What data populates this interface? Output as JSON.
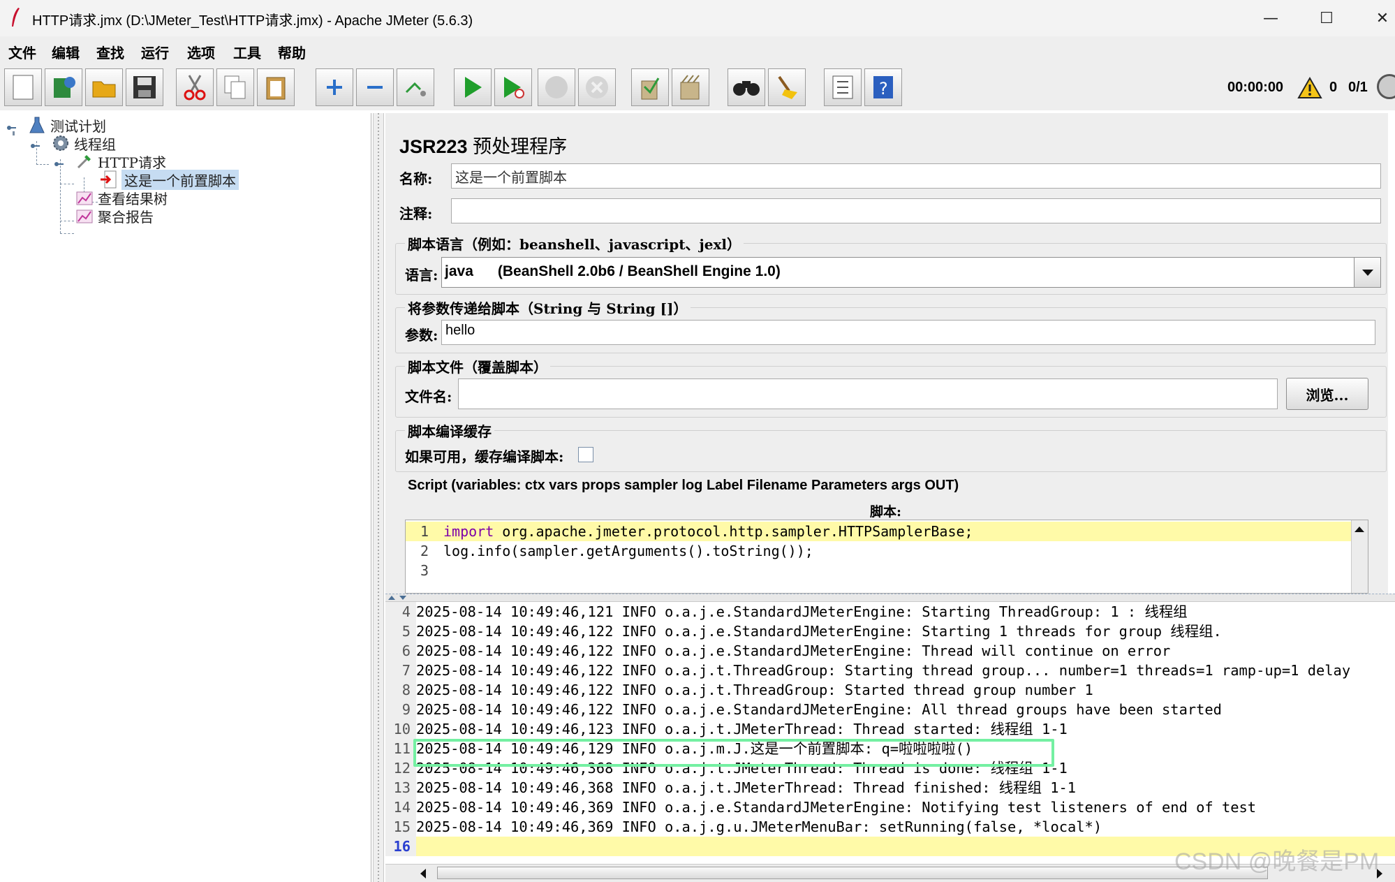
{
  "window": {
    "title": "HTTP请求.jmx (D:\\JMeter_Test\\HTTP请求.jmx) - Apache JMeter (5.6.3)",
    "minimize": "—",
    "maximize": "☐",
    "close": "✕"
  },
  "menu": [
    "文件",
    "编辑",
    "查找",
    "运行",
    "选项",
    "工具",
    "帮助"
  ],
  "toolbar": {
    "buttons": [
      "new-icon",
      "templates-icon",
      "open-icon",
      "save-icon",
      "cut-icon",
      "copy-icon",
      "paste-icon",
      "expand-icon",
      "collapse-icon",
      "toggle-icon",
      "start-icon",
      "start-no-pause-icon",
      "stop-icon",
      "shutdown-icon",
      "clear-icon",
      "clear-all-icon",
      "search-icon",
      "reset-search-icon",
      "function-helper-icon",
      "help-icon"
    ],
    "timer": "00:00:00",
    "error_count": "0",
    "threads": "0/1"
  },
  "tree": {
    "nodes": [
      {
        "label": "测试计划",
        "icon": "test-plan-icon"
      },
      {
        "label": "线程组",
        "icon": "gear-icon"
      },
      {
        "label": "HTTP请求",
        "icon": "pipette-icon"
      },
      {
        "label": "这是一个前置脚本",
        "icon": "preprocessor-icon",
        "selected": true
      },
      {
        "label": "查看结果树",
        "icon": "listener-icon"
      },
      {
        "label": "聚合报告",
        "icon": "listener-icon"
      }
    ]
  },
  "editor": {
    "title_latin": "JSR223",
    "title_cjk": "预处理程序",
    "name_label": "名称:",
    "name_value": "这是一个前置脚本",
    "comment_label": "注释:",
    "comment_value": "",
    "lang_group": "脚本语言（例如：beanshell、javascript、jexl）",
    "lang_label": "语言:",
    "lang_value": "java      (BeanShell 2.0b6 / BeanShell Engine 1.0)",
    "params_group": "将参数传递给脚本（String 与 String []）",
    "params_label": "参数:",
    "params_value": "hello",
    "file_group": "脚本文件（覆盖脚本）",
    "file_label": "文件名:",
    "file_value": "",
    "browse_label": "浏览...",
    "cache_group": "脚本编译缓存",
    "cache_label": "如果可用，缓存编译脚本:",
    "cache_checked": false,
    "script_group": "Script (variables: ctx vars props sampler log Label Filename Parameters args OUT)",
    "script_label": "脚本:",
    "script_lines": [
      {
        "n": "1",
        "kw": "import",
        "text": " org.apache.jmeter.protocol.http.sampler.HTTPSamplerBase;"
      },
      {
        "n": "2",
        "kw": "",
        "text": "log.info(sampler.getArguments().toString());"
      },
      {
        "n": "3",
        "kw": "",
        "text": ""
      }
    ]
  },
  "log": {
    "lines": [
      {
        "n": "4",
        "text": "2025-08-14 10:49:46,121 INFO o.a.j.e.StandardJMeterEngine: Starting ThreadGroup: 1 : 线程组"
      },
      {
        "n": "5",
        "text": "2025-08-14 10:49:46,122 INFO o.a.j.e.StandardJMeterEngine: Starting 1 threads for group 线程组."
      },
      {
        "n": "6",
        "text": "2025-08-14 10:49:46,122 INFO o.a.j.e.StandardJMeterEngine: Thread will continue on error"
      },
      {
        "n": "7",
        "text": "2025-08-14 10:49:46,122 INFO o.a.j.t.ThreadGroup: Starting thread group... number=1 threads=1 ramp-up=1 delay"
      },
      {
        "n": "8",
        "text": "2025-08-14 10:49:46,122 INFO o.a.j.t.ThreadGroup: Started thread group number 1"
      },
      {
        "n": "9",
        "text": "2025-08-14 10:49:46,122 INFO o.a.j.e.StandardJMeterEngine: All thread groups have been started"
      },
      {
        "n": "10",
        "text": "2025-08-14 10:49:46,123 INFO o.a.j.t.JMeterThread: Thread started: 线程组 1-1"
      },
      {
        "n": "11",
        "text": "2025-08-14 10:49:46,129 INFO o.a.j.m.J.这是一个前置脚本: q=啦啦啦啦()"
      },
      {
        "n": "12",
        "text": "2025-08-14 10:49:46,368 INFO o.a.j.t.JMeterThread: Thread is done: 线程组 1-1"
      },
      {
        "n": "13",
        "text": "2025-08-14 10:49:46,368 INFO o.a.j.t.JMeterThread: Thread finished: 线程组 1-1"
      },
      {
        "n": "14",
        "text": "2025-08-14 10:49:46,369 INFO o.a.j.e.StandardJMeterEngine: Notifying test listeners of end of test"
      },
      {
        "n": "15",
        "text": "2025-08-14 10:49:46,369 INFO o.a.j.g.u.JMeterMenuBar: setRunning(false, *local*)"
      },
      {
        "n": "16",
        "text": ""
      }
    ]
  },
  "watermark": "CSDN @晚餐是PM",
  "colors": {
    "highlight_box": "#74f0a2",
    "active_line": "#fffaa8",
    "selected_node": "#c6dcf2",
    "keyword": "#7d00a8"
  }
}
